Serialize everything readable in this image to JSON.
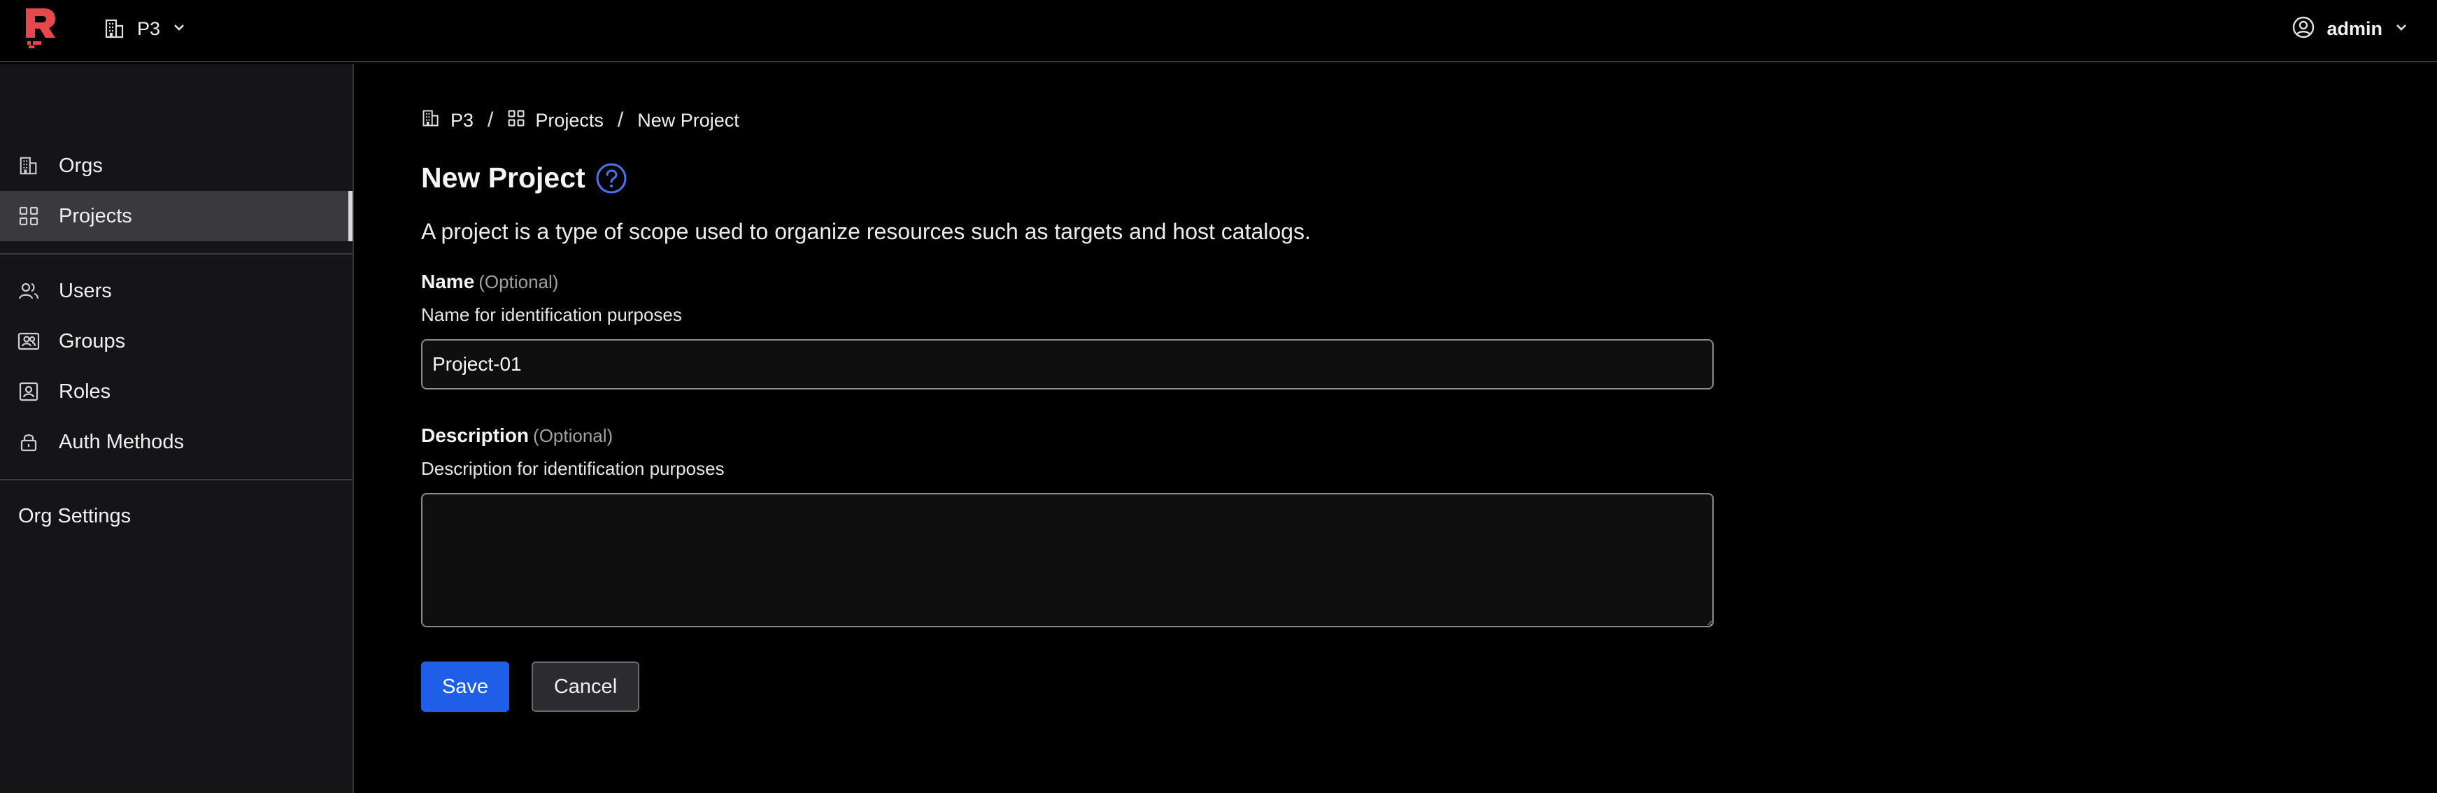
{
  "topbar": {
    "org_switcher": {
      "label": "P3"
    },
    "user_menu": {
      "label": "admin"
    }
  },
  "sidebar": {
    "items": [
      {
        "label": "Orgs",
        "icon": "building-icon"
      },
      {
        "label": "Projects",
        "icon": "grid-icon",
        "active": true
      },
      {
        "label": "Users",
        "icon": "users-icon"
      },
      {
        "label": "Groups",
        "icon": "groups-icon"
      },
      {
        "label": "Roles",
        "icon": "id-badge-icon"
      },
      {
        "label": "Auth Methods",
        "icon": "lock-icon"
      }
    ],
    "settings_label": "Org Settings"
  },
  "breadcrumb": {
    "items": [
      {
        "label": "P3",
        "icon": "building-icon"
      },
      {
        "label": "Projects",
        "icon": "grid-icon"
      },
      {
        "label": "New Project"
      }
    ],
    "separator": "/"
  },
  "page": {
    "title": "New Project",
    "description": "A project is a type of scope used to organize resources such as targets and host catalogs."
  },
  "form": {
    "name": {
      "label": "Name",
      "optional": "(Optional)",
      "help": "Name for identification purposes",
      "value": "Project-01"
    },
    "description": {
      "label": "Description",
      "optional": "(Optional)",
      "help": "Description for identification purposes",
      "value": ""
    },
    "save_label": "Save",
    "cancel_label": "Cancel"
  },
  "colors": {
    "accent": "#1f5ee6",
    "logo": "#e5484d",
    "help_icon": "#4c73f0",
    "background": "#000000",
    "sidebar": "#151517"
  }
}
